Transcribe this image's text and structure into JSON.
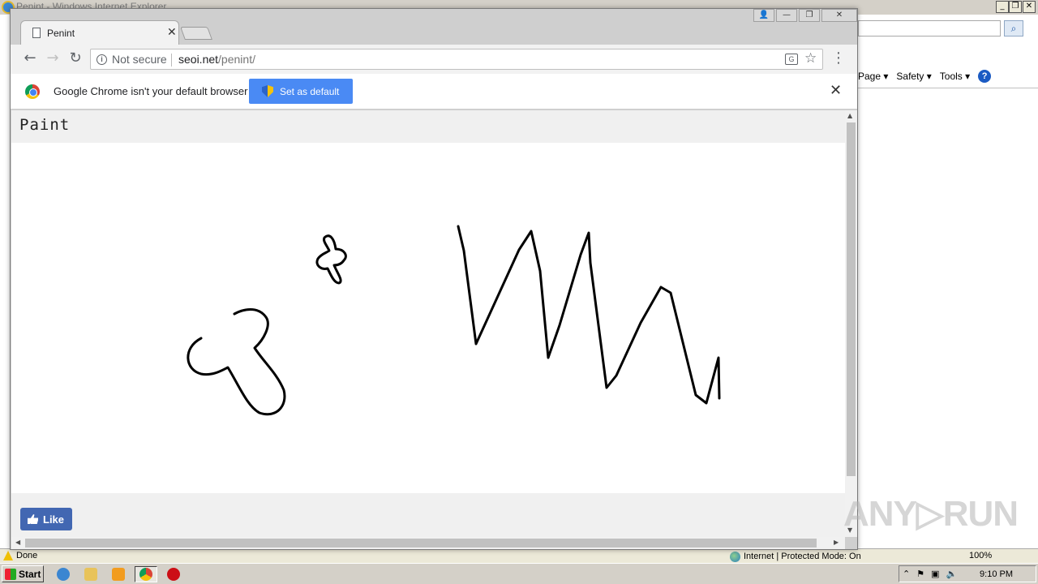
{
  "ie": {
    "title": "Penint - Windows Internet Explorer",
    "toolbar": {
      "page_label": "Page ▾",
      "safety_label": "Safety ▾",
      "tools_label": "Tools ▾",
      "help_label": "?"
    },
    "status": {
      "done": "Done",
      "zone": "Internet | Protected Mode: On",
      "zoom": "100%"
    }
  },
  "chrome": {
    "tab": {
      "title": "Penint"
    },
    "omnibox": {
      "security": "Not secure",
      "host": "seoi.net",
      "path": "/penint/"
    },
    "infobar": {
      "message": "Google Chrome isn't your default browser",
      "button_label": "Set as default"
    },
    "window_controls": {
      "minimize": "—",
      "maximize": "❐",
      "close": "✕"
    }
  },
  "page": {
    "title": "Paint",
    "like_label": "Like"
  },
  "drawing": {
    "stroke_color": "#000000",
    "strokes": [
      "M248,416 C225,428 228,455 248,460 C262,463 275,455 281,452 C295,475 305,500 320,508 C340,515 355,500 350,480 C342,460 325,445 314,428 C325,418 335,400 328,390 C318,376 300,380 289,386",
      "M400,292 C406,286 412,292 414,306 C424,306 430,314 424,320 C420,326 414,326 412,326 C416,336 424,346 418,348 C412,348 408,338 404,330 C396,332 388,326 392,318 C396,312 404,310 406,308 C402,300 398,296 400,292 Z",
      "M565,278 L572,308 L587,423 L640,307 L655,284 L666,333 L676,440 L690,400 L716,313 L726,286 L728,323 L748,477 L760,462 L790,397 L815,353 L827,360 L858,486 L871,496 L886,440 L887,490"
    ]
  },
  "taskbar": {
    "start_label": "Start",
    "clock": "9:10 PM"
  },
  "watermark": "ANY▷RUN"
}
